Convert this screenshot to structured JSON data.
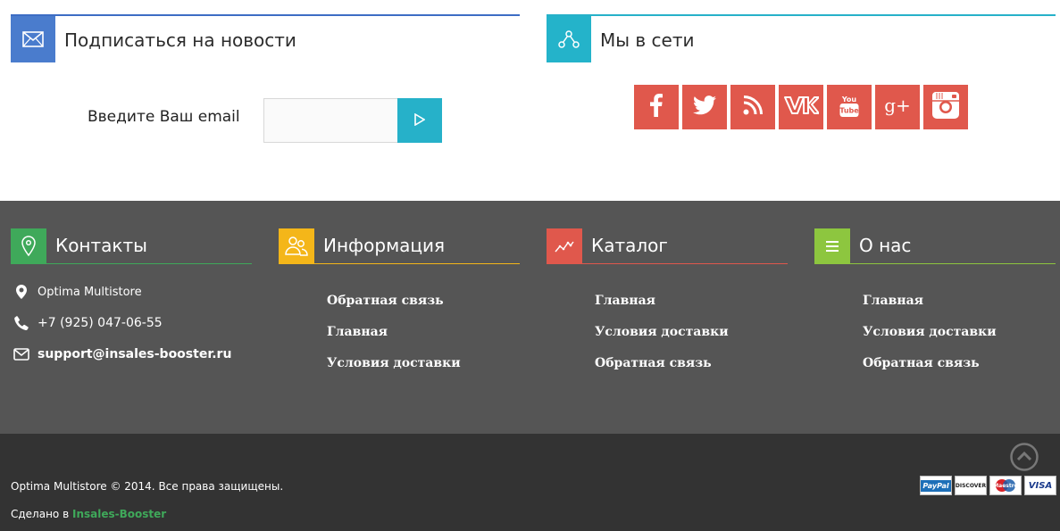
{
  "newsletter": {
    "title": "Подписаться на новости",
    "email_label": "Введите Ваш email",
    "email_value": "",
    "email_placeholder": "",
    "icon": "envelope-icon"
  },
  "social": {
    "title": "Мы в сети",
    "icon": "share-icon",
    "networks": [
      "facebook",
      "twitter",
      "rss",
      "vk",
      "youtube",
      "google-plus",
      "instagram"
    ],
    "youtube_text": "You Tube",
    "gplus_text": "g+"
  },
  "footer": {
    "contacts": {
      "title": "Контакты",
      "address": "Optima Multistore",
      "phone": "+7 (925) 047-06-55",
      "email": "support@insales-booster.ru"
    },
    "info": {
      "title": "Информация",
      "links": [
        "Обратная связь",
        "Главная",
        "Условия доставки"
      ]
    },
    "catalog": {
      "title": "Каталог",
      "links": [
        "Главная",
        "Условия доставки",
        "Обратная связь"
      ]
    },
    "about": {
      "title": "О нас",
      "links": [
        "Главная",
        "Условия доставки",
        "Обратная связь"
      ]
    }
  },
  "bottom": {
    "copyright": "Optima Multistore © 2014. Все права защищены.",
    "made_by_prefix": "Сделано в ",
    "made_by_brand": "Insales-Booster",
    "payments": [
      "PayPal",
      "DISCOVER",
      "Maestro",
      "VISA"
    ]
  },
  "colors": {
    "newsletter_accent": "#4a7ccd",
    "social_accent": "#24b3ca",
    "social_buttons": "#e0584c",
    "contacts": "#3fa95a",
    "info": "#f4b619",
    "catalog": "#e0584c",
    "about": "#8dc63f",
    "footer_bg": "#555555",
    "bottom_bg": "#333333"
  }
}
